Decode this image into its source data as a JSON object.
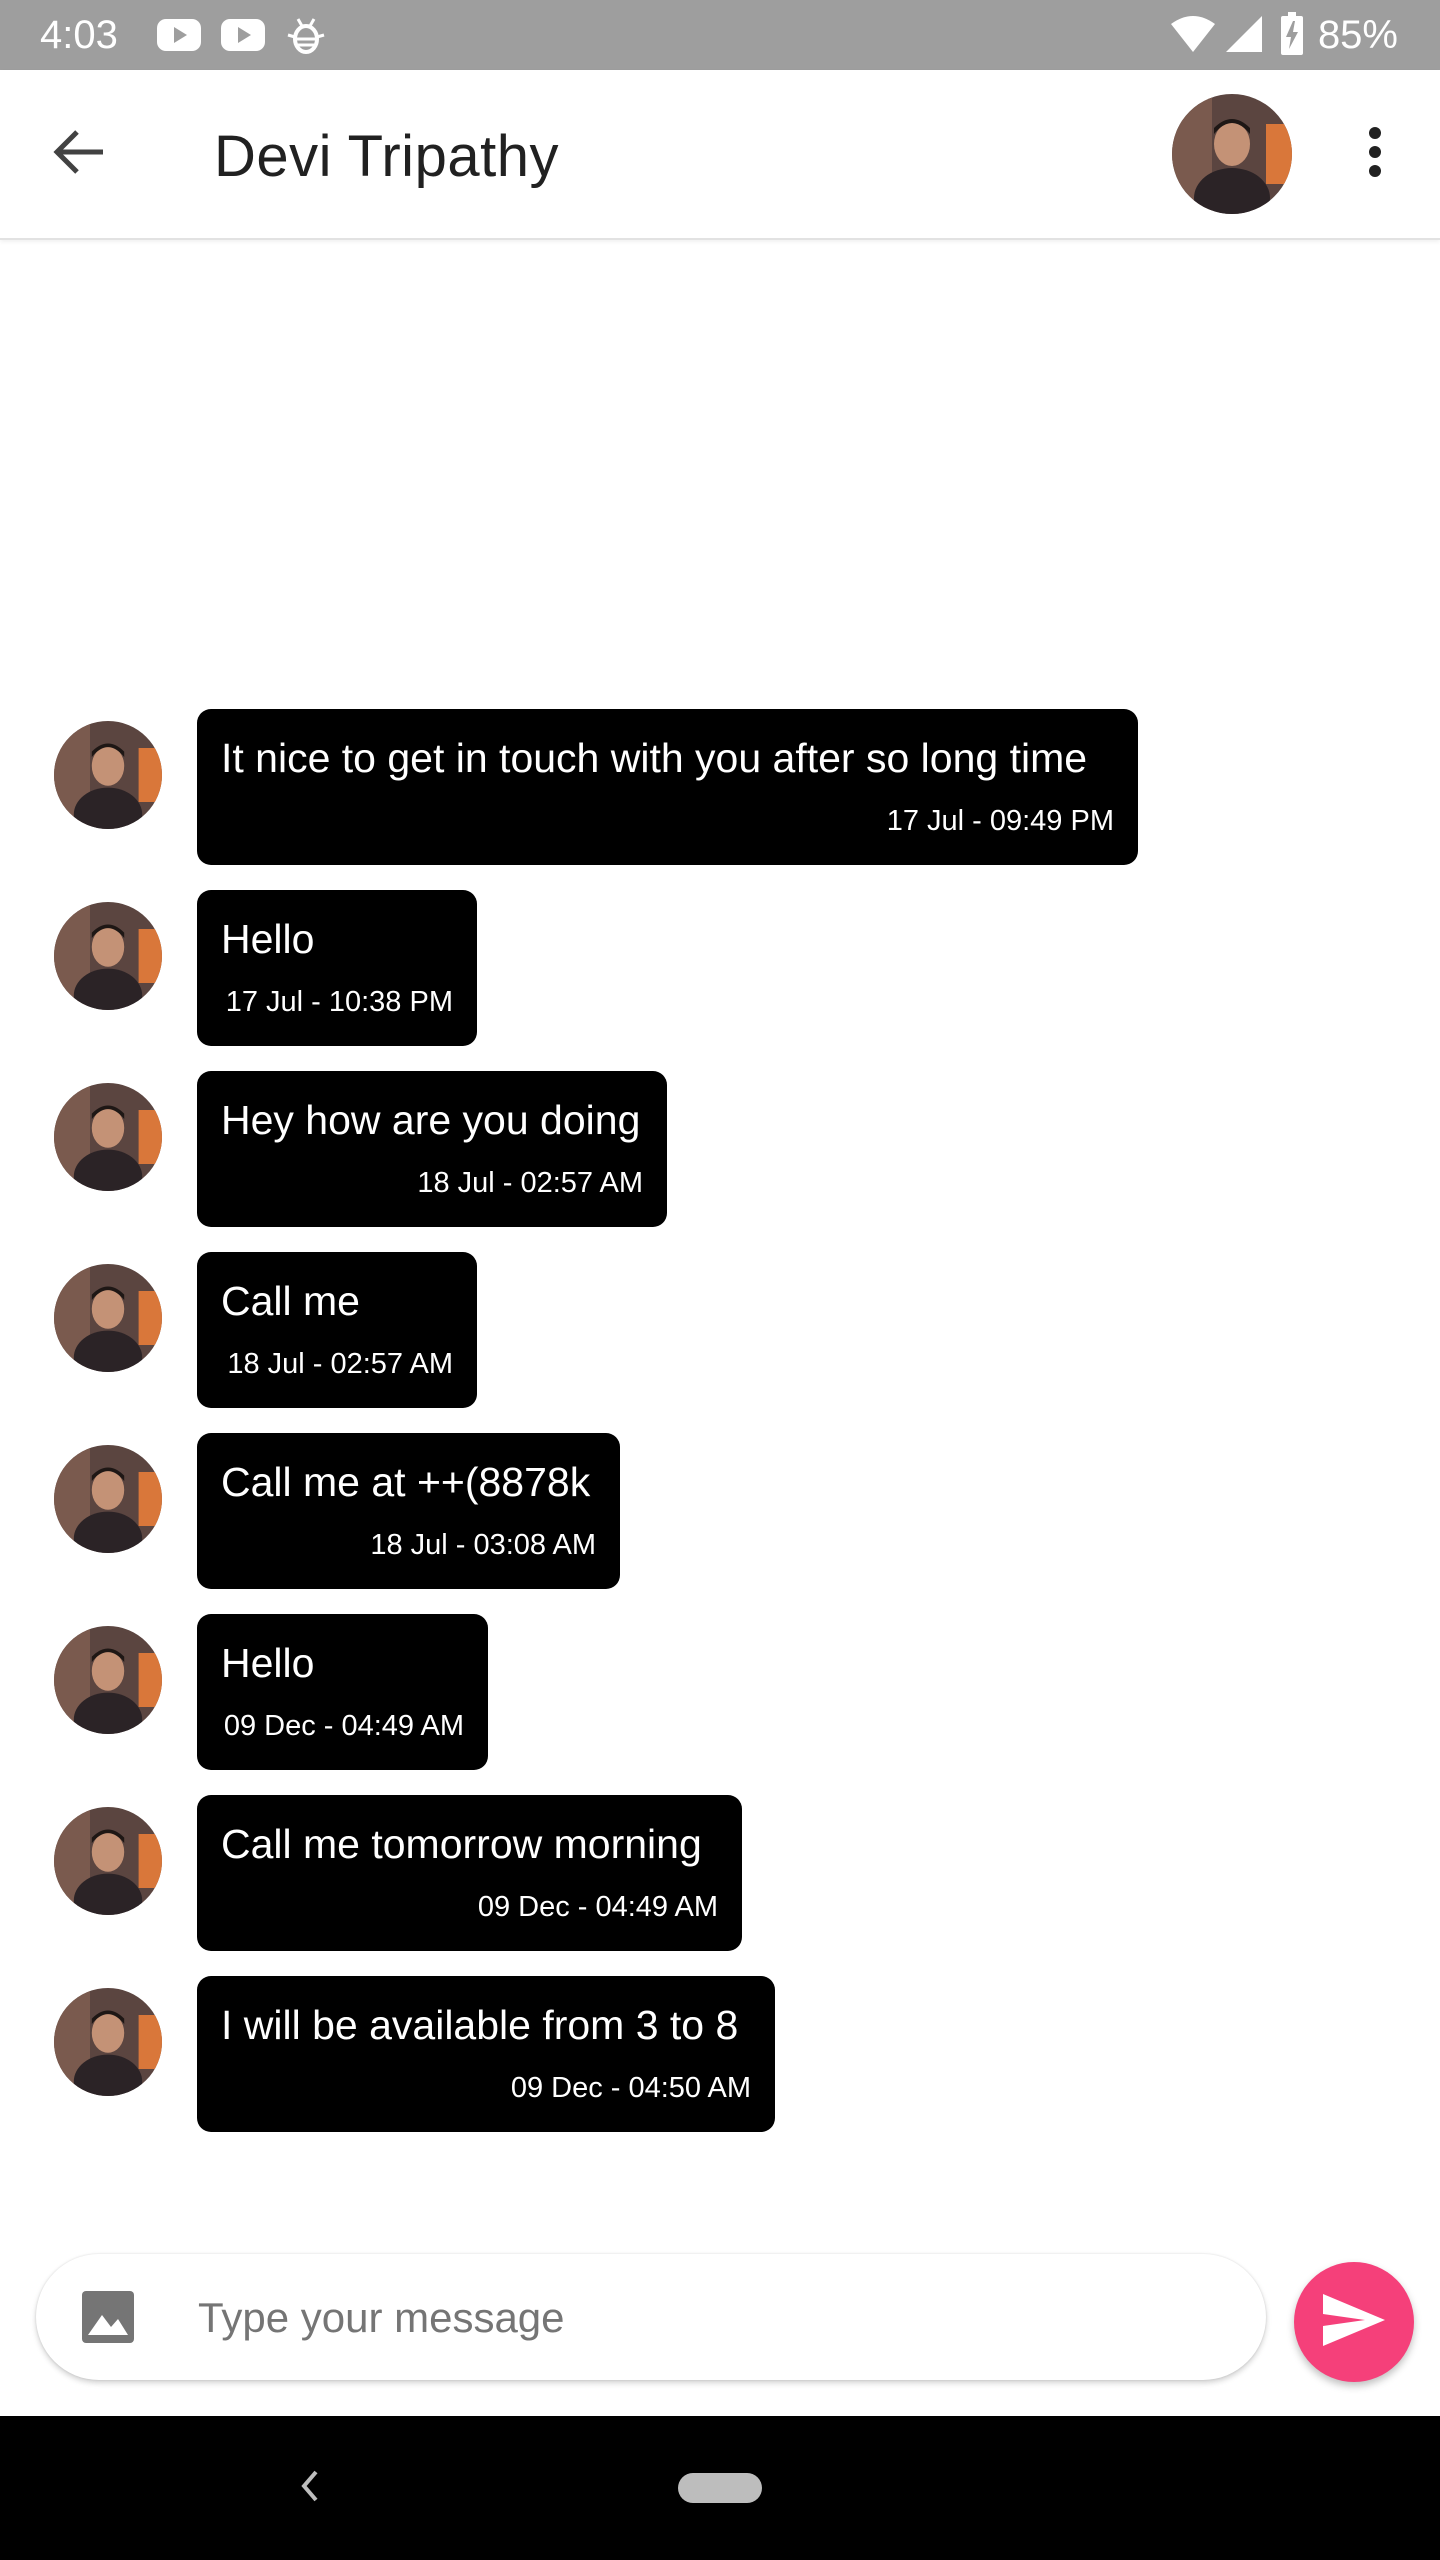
{
  "status_bar": {
    "time": "4:03",
    "battery_percent": "85%",
    "icons": [
      "youtube-icon",
      "youtube-icon",
      "bug-icon",
      "wifi-icon",
      "signal-icon",
      "battery-charging-icon"
    ]
  },
  "header": {
    "title": "Devi Tripathy",
    "back_icon": "arrow-back-icon",
    "menu_icon": "more-vert-icon"
  },
  "messages": [
    {
      "text": "It nice to get in touch with you after so long time",
      "time": "17 Jul - 09:49 PM"
    },
    {
      "text": "Hello",
      "time": "17 Jul - 10:38 PM"
    },
    {
      "text": "Hey how are you doing",
      "time": "18 Jul - 02:57 AM"
    },
    {
      "text": "Call me",
      "time": "18 Jul - 02:57 AM"
    },
    {
      "text": "Call me at ++(8878k",
      "time": "18 Jul - 03:08 AM"
    },
    {
      "text": "Hello",
      "time": "09 Dec - 04:49 AM"
    },
    {
      "text": "Call me tomorrow morning",
      "time": "09 Dec - 04:49 AM"
    },
    {
      "text": "I will be available from 3 to 8",
      "time": "09 Dec - 04:50 AM"
    }
  ],
  "composer": {
    "placeholder": "Type your message",
    "value": "",
    "attach_icon": "image-icon",
    "send_icon": "send-icon"
  },
  "colors": {
    "status_bar": "#9e9e9e",
    "bubble": "#000000",
    "send_button": "#f5407a",
    "nav_bar": "#000000"
  }
}
